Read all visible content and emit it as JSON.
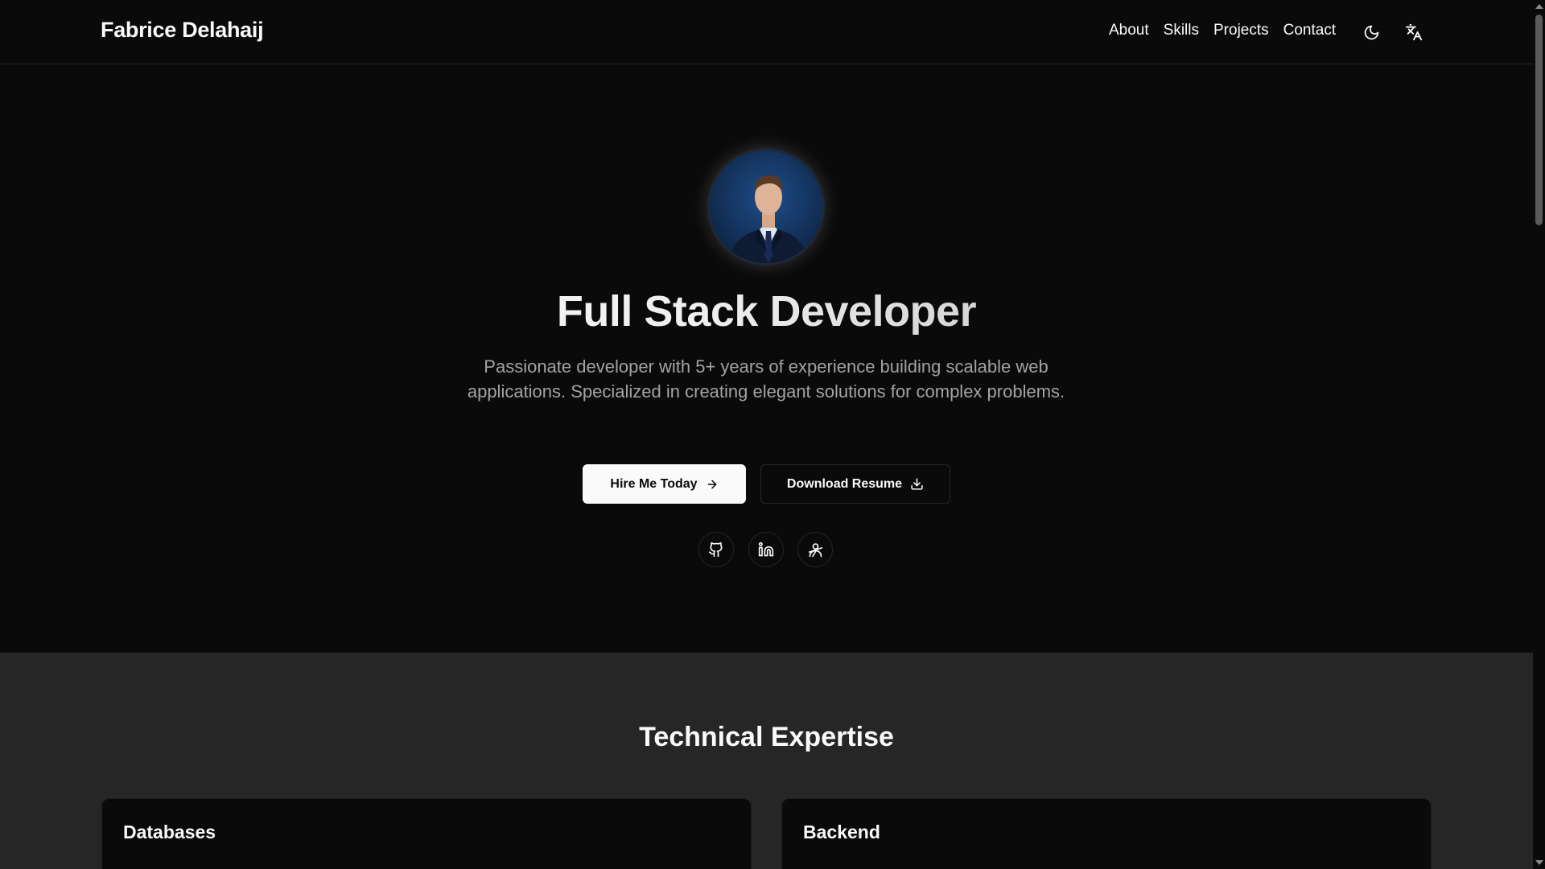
{
  "header": {
    "brand": "Fabrice Delahaij",
    "nav": [
      {
        "label": "About"
      },
      {
        "label": "Skills"
      },
      {
        "label": "Projects"
      },
      {
        "label": "Contact"
      }
    ],
    "theme_icon": "moon-icon",
    "language_icon": "translate-icon"
  },
  "hero": {
    "avatar_icon": "profile-photo",
    "title": "Full Stack Developer",
    "description": "Passionate developer with 5+ years of experience building scalable web applications. Specialized in creating elegant solutions for complex problems.",
    "primary_button": "Hire Me Today",
    "primary_button_icon": "arrow-right-icon",
    "secondary_button": "Download Resume",
    "secondary_button_icon": "download-icon",
    "social_icons": [
      "github-icon",
      "linkedin-icon",
      "malt-icon"
    ]
  },
  "skills": {
    "title": "Technical Expertise",
    "cards": [
      {
        "title": "Databases"
      },
      {
        "title": "Backend"
      }
    ]
  },
  "colors": {
    "background": "#0a0a0a",
    "section_background": "#262626",
    "text": "#fafafa",
    "muted_text": "#a3a3a3",
    "border": "#262626"
  }
}
